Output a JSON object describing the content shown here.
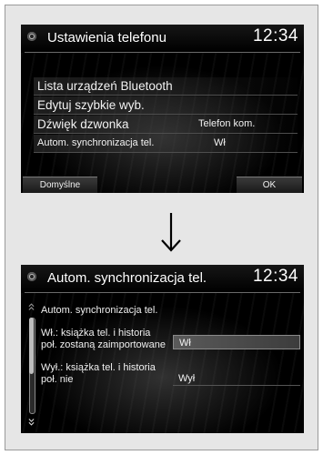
{
  "screen1": {
    "title": "Ustawienia telefonu",
    "clock": "12:34",
    "items": [
      {
        "label": "Lista urządzeń Bluetooth",
        "value": ""
      },
      {
        "label": "Edytuj szybkie wyb.",
        "value": ""
      },
      {
        "label": "Dźwięk dzwonka",
        "value": "Telefon kom."
      },
      {
        "label": "Autom. synchronizacja tel.",
        "value": "Wł"
      }
    ],
    "softkeys": {
      "left": "Domyślne",
      "right": "OK"
    }
  },
  "arrow_icon": "down-arrow-icon",
  "screen2": {
    "title": "Autom. synchronizacja tel.",
    "clock": "12:34",
    "description": [
      "Autom. synchronizacja tel.",
      "Wł.: książka tel. i historia poł. zostaną zaimportowane",
      "Wył.: książka tel. i historia poł. nie"
    ],
    "options": [
      {
        "label": "Wł",
        "selected": true
      },
      {
        "label": "Wył",
        "selected": false
      }
    ],
    "scroll_position": 0.0
  },
  "colors": {
    "screen_bg": "#000000",
    "frame_bg": "#e6e6e6",
    "highlight": "#5a5a5a"
  }
}
